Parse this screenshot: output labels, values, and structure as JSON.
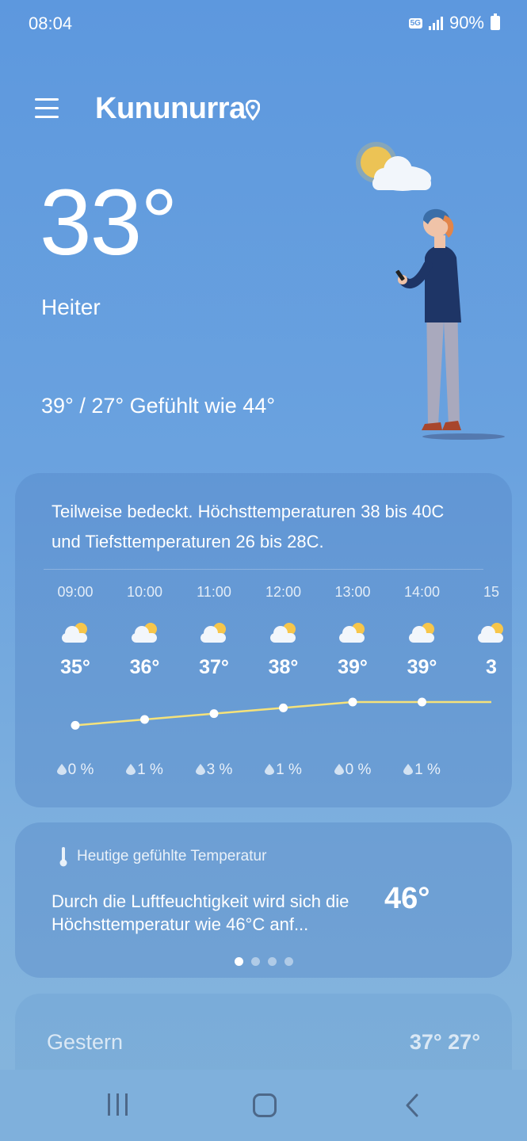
{
  "status": {
    "time": "08:04",
    "network": "5G",
    "battery": "90%"
  },
  "header": {
    "city": "Kununurra"
  },
  "current": {
    "temp": "33°",
    "condition": "Heiter",
    "hilo_feels": "39° / 27° Gefühlt wie 44°"
  },
  "forecast_card": {
    "summary": "Teilweise bedeckt. Höchsttemperaturen 38 bis 40C und Tiefsttemperaturen 26 bis 28C.",
    "hours": [
      {
        "time": "09:00",
        "temp": "35°",
        "precip": "0 %",
        "value": 35
      },
      {
        "time": "10:00",
        "temp": "36°",
        "precip": "1 %",
        "value": 36
      },
      {
        "time": "11:00",
        "temp": "37°",
        "precip": "3 %",
        "value": 37
      },
      {
        "time": "12:00",
        "temp": "38°",
        "precip": "1 %",
        "value": 38
      },
      {
        "time": "13:00",
        "temp": "39°",
        "precip": "0 %",
        "value": 39
      },
      {
        "time": "14:00",
        "temp": "39°",
        "precip": "1 %",
        "value": 39
      },
      {
        "time": "15",
        "temp": "3",
        "precip": "",
        "value": 39
      }
    ]
  },
  "feels_card": {
    "heading": "Heutige gefühlte Temperatur",
    "text": "Durch die Luftfeuchtigkeit wird sich die Höchsttemperatur wie 46°C anf...",
    "value": "46°",
    "pages": 4,
    "active_page": 0
  },
  "yesterday": {
    "label": "Gestern",
    "values": "37° 27°"
  },
  "colors": {
    "temp_line": "#f5e27a",
    "sun": "#f7c64a"
  }
}
